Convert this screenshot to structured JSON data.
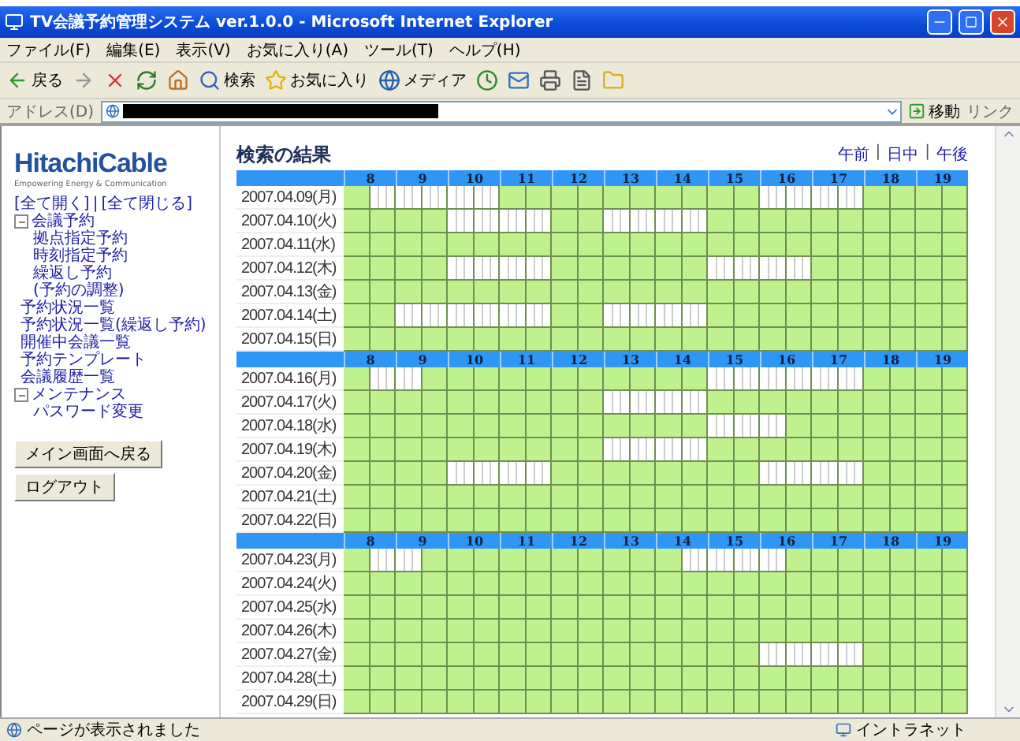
{
  "window": {
    "title": "TV会議予約管理システム ver.1.0.0 - Microsoft Internet Explorer"
  },
  "menu": [
    "ファイル(F)",
    "編集(E)",
    "表示(V)",
    "お気に入り(A)",
    "ツール(T)",
    "ヘルプ(H)"
  ],
  "toolbar": [
    {
      "kind": "back",
      "label": "戻る"
    },
    {
      "kind": "forward"
    },
    {
      "kind": "stop"
    },
    {
      "kind": "refresh"
    },
    {
      "kind": "home"
    },
    {
      "kind": "search",
      "label": "検索"
    },
    {
      "kind": "favorites",
      "label": "お気に入り"
    },
    {
      "kind": "media",
      "label": "メディア"
    },
    {
      "kind": "history"
    },
    {
      "kind": "mail"
    },
    {
      "kind": "print"
    },
    {
      "kind": "edit"
    },
    {
      "kind": "folder"
    }
  ],
  "address": {
    "label": "アドレス(D)",
    "go": "移動",
    "links": "リンク"
  },
  "sidebar": {
    "logo": "HitachiCable",
    "tagline": "Empowering Energy & Communication",
    "expand_all": "[全て開く]",
    "separator": "|",
    "collapse_all": "[全て閉じる]",
    "tree": [
      {
        "label": "会議予約",
        "expanded": true,
        "children": [
          {
            "label": "拠点指定予約"
          },
          {
            "label": "時刻指定予約"
          },
          {
            "label": "繰返し予約"
          },
          {
            "label": "(予約の調整)"
          }
        ]
      },
      {
        "label": "予約状況一覧"
      },
      {
        "label": "予約状況一覧(繰返し予約)"
      },
      {
        "label": "開催中会議一覧"
      },
      {
        "label": "予約テンプレート"
      },
      {
        "label": "会議履歴一覧"
      },
      {
        "label": "メンテナンス",
        "expanded": true,
        "children": [
          {
            "label": "パスワード変更"
          }
        ]
      }
    ],
    "buttons": [
      "メイン画面へ戻る",
      "ログアウト"
    ]
  },
  "main": {
    "title": "検索の結果",
    "period_links": [
      {
        "kind": "link",
        "label": "午前"
      },
      {
        "kind": "separator",
        "label": "|"
      },
      {
        "kind": "link",
        "label": "日中"
      },
      {
        "kind": "separator",
        "label": "|"
      },
      {
        "kind": "link",
        "label": "午後"
      }
    ],
    "weeks": [
      {
        "hours": [
          "8",
          "9",
          "10",
          "11",
          "12",
          "13",
          "14",
          "15",
          "16",
          "17",
          "18",
          "19"
        ],
        "rows": [
          {
            "date": "2007.04.09(月)",
            "booked": [
              false,
              true,
              true,
              true,
              true,
              true,
              false,
              false,
              false,
              false,
              false,
              false,
              false,
              false,
              false,
              false,
              true,
              true,
              true,
              true,
              false,
              false,
              false,
              false
            ]
          },
          {
            "date": "2007.04.10(火)",
            "booked": [
              false,
              false,
              false,
              false,
              true,
              true,
              true,
              true,
              false,
              false,
              true,
              true,
              true,
              true,
              false,
              false,
              false,
              false,
              false,
              false,
              false,
              false,
              false,
              false
            ]
          },
          {
            "date": "2007.04.11(水)",
            "booked": [
              false,
              false,
              false,
              false,
              false,
              false,
              false,
              false,
              false,
              false,
              false,
              false,
              false,
              false,
              false,
              false,
              false,
              false,
              false,
              false,
              false,
              false,
              false,
              false
            ]
          },
          {
            "date": "2007.04.12(木)",
            "booked": [
              false,
              false,
              false,
              false,
              true,
              true,
              true,
              true,
              false,
              false,
              false,
              false,
              false,
              false,
              true,
              true,
              true,
              true,
              false,
              false,
              false,
              false,
              false,
              false
            ]
          },
          {
            "date": "2007.04.13(金)",
            "booked": [
              false,
              false,
              false,
              false,
              false,
              false,
              false,
              false,
              false,
              false,
              false,
              false,
              false,
              false,
              false,
              false,
              false,
              false,
              false,
              false,
              false,
              false,
              false,
              false
            ]
          },
          {
            "date": "2007.04.14(土)",
            "booked": [
              false,
              false,
              true,
              true,
              true,
              true,
              true,
              true,
              false,
              false,
              true,
              true,
              true,
              true,
              false,
              false,
              false,
              false,
              false,
              false,
              false,
              false,
              false,
              false
            ]
          },
          {
            "date": "2007.04.15(日)",
            "booked": [
              false,
              false,
              false,
              false,
              false,
              false,
              false,
              false,
              false,
              false,
              false,
              false,
              false,
              false,
              false,
              false,
              false,
              false,
              false,
              false,
              false,
              false,
              false,
              false
            ]
          }
        ]
      },
      {
        "hours": [
          "8",
          "9",
          "10",
          "11",
          "12",
          "13",
          "14",
          "15",
          "16",
          "17",
          "18",
          "19"
        ],
        "rows": [
          {
            "date": "2007.04.16(月)",
            "booked": [
              false,
              true,
              true,
              false,
              false,
              false,
              false,
              false,
              false,
              false,
              false,
              false,
              false,
              false,
              true,
              true,
              true,
              true,
              true,
              true,
              false,
              false,
              false,
              false
            ]
          },
          {
            "date": "2007.04.17(火)",
            "booked": [
              false,
              false,
              false,
              false,
              false,
              false,
              false,
              false,
              false,
              false,
              true,
              true,
              true,
              true,
              false,
              false,
              false,
              false,
              false,
              false,
              false,
              false,
              false,
              false
            ]
          },
          {
            "date": "2007.04.18(水)",
            "booked": [
              false,
              false,
              false,
              false,
              false,
              false,
              false,
              false,
              false,
              false,
              false,
              false,
              false,
              false,
              true,
              true,
              true,
              false,
              false,
              false,
              false,
              false,
              false,
              false
            ]
          },
          {
            "date": "2007.04.19(木)",
            "booked": [
              false,
              false,
              false,
              false,
              false,
              false,
              false,
              false,
              false,
              false,
              true,
              true,
              true,
              true,
              false,
              false,
              false,
              false,
              false,
              false,
              false,
              false,
              false,
              false
            ]
          },
          {
            "date": "2007.04.20(金)",
            "booked": [
              false,
              false,
              false,
              false,
              true,
              true,
              true,
              true,
              false,
              false,
              false,
              false,
              false,
              false,
              false,
              false,
              true,
              true,
              true,
              true,
              false,
              false,
              false,
              false
            ]
          },
          {
            "date": "2007.04.21(土)",
            "booked": [
              false,
              false,
              false,
              false,
              false,
              false,
              false,
              false,
              false,
              false,
              false,
              false,
              false,
              false,
              false,
              false,
              false,
              false,
              false,
              false,
              false,
              false,
              false,
              false
            ]
          },
          {
            "date": "2007.04.22(日)",
            "booked": [
              false,
              false,
              false,
              false,
              false,
              false,
              false,
              false,
              false,
              false,
              false,
              false,
              false,
              false,
              false,
              false,
              false,
              false,
              false,
              false,
              false,
              false,
              false,
              false
            ]
          }
        ]
      },
      {
        "hours": [
          "8",
          "9",
          "10",
          "11",
          "12",
          "13",
          "14",
          "15",
          "16",
          "17",
          "18",
          "19"
        ],
        "rows": [
          {
            "date": "2007.04.23(月)",
            "booked": [
              false,
              true,
              true,
              false,
              false,
              false,
              false,
              false,
              false,
              false,
              false,
              false,
              false,
              true,
              true,
              true,
              true,
              false,
              false,
              false,
              false,
              false,
              false,
              false
            ]
          },
          {
            "date": "2007.04.24(火)",
            "booked": [
              false,
              false,
              false,
              false,
              false,
              false,
              false,
              false,
              false,
              false,
              false,
              false,
              false,
              false,
              false,
              false,
              false,
              false,
              false,
              false,
              false,
              false,
              false,
              false
            ]
          },
          {
            "date": "2007.04.25(水)",
            "booked": [
              false,
              false,
              false,
              false,
              false,
              false,
              false,
              false,
              false,
              false,
              false,
              false,
              false,
              false,
              false,
              false,
              false,
              false,
              false,
              false,
              false,
              false,
              false,
              false
            ]
          },
          {
            "date": "2007.04.26(木)",
            "booked": [
              false,
              false,
              false,
              false,
              false,
              false,
              false,
              false,
              false,
              false,
              false,
              false,
              false,
              false,
              false,
              false,
              false,
              false,
              false,
              false,
              false,
              false,
              false,
              false
            ]
          },
          {
            "date": "2007.04.27(金)",
            "booked": [
              false,
              false,
              false,
              false,
              false,
              false,
              false,
              false,
              false,
              false,
              false,
              false,
              false,
              false,
              false,
              false,
              true,
              true,
              true,
              true,
              false,
              false,
              false,
              false
            ]
          },
          {
            "date": "2007.04.28(土)",
            "booked": [
              false,
              false,
              false,
              false,
              false,
              false,
              false,
              false,
              false,
              false,
              false,
              false,
              false,
              false,
              false,
              false,
              false,
              false,
              false,
              false,
              false,
              false,
              false,
              false
            ]
          },
          {
            "date": "2007.04.29(日)",
            "booked": [
              false,
              false,
              false,
              false,
              false,
              false,
              false,
              false,
              false,
              false,
              false,
              false,
              false,
              false,
              false,
              false,
              false,
              false,
              false,
              false,
              false,
              false,
              false,
              false
            ]
          }
        ]
      }
    ]
  },
  "status_bar": {
    "text": "ページが表示されました",
    "zone": "イントラネット"
  }
}
